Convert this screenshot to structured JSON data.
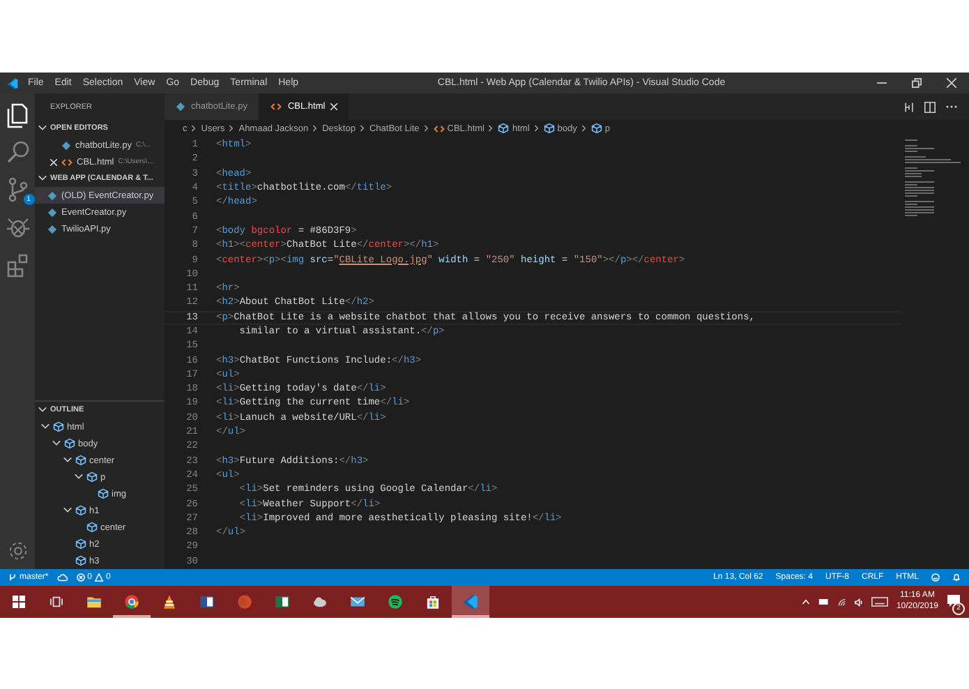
{
  "title_bar": {
    "menu": [
      "File",
      "Edit",
      "Selection",
      "View",
      "Go",
      "Debug",
      "Terminal",
      "Help"
    ],
    "title": "CBL.html - Web App (Calendar & Twilio APIs) - Visual Studio Code"
  },
  "activity_bar": {
    "items": [
      {
        "kind": "files",
        "selected": true
      },
      {
        "kind": "search",
        "selected": false
      },
      {
        "kind": "source-control",
        "selected": false,
        "badge": "1"
      },
      {
        "kind": "debug",
        "selected": false
      },
      {
        "kind": "extensions",
        "selected": false
      }
    ]
  },
  "sidebar": {
    "title": "EXPLORER",
    "sections": [
      {
        "title": "OPEN EDITORS",
        "expanded": true,
        "items": [
          {
            "name": "chatbotLite.py",
            "path": "C:\\...",
            "kind": "python",
            "selected": false,
            "close": false
          },
          {
            "name": "CBL.html",
            "path": "C:\\Users\\...",
            "kind": "html",
            "selected": false,
            "close": true
          }
        ]
      },
      {
        "title": "WEB APP (CALENDAR & T...",
        "expanded": true,
        "items": [
          {
            "name": "(OLD) EventCreator.py",
            "kind": "python",
            "selected": true,
            "close": false
          },
          {
            "name": "EventCreator.py",
            "kind": "python",
            "selected": false,
            "close": false
          },
          {
            "name": "TwilioAPI.py",
            "kind": "python",
            "selected": false,
            "close": false
          }
        ]
      }
    ],
    "outline": {
      "title": "OUTLINE",
      "expanded": true,
      "items": [
        {
          "label": "html",
          "expanded": true,
          "children": [
            {
              "label": "body",
              "expanded": true,
              "children": [
                {
                  "label": "center",
                  "expanded": true,
                  "children": [
                    {
                      "label": "p",
                      "expanded": true,
                      "children": [
                        {
                          "label": "img"
                        }
                      ]
                    }
                  ]
                },
                {
                  "label": "h1",
                  "expanded": true,
                  "children": [
                    {
                      "label": "center"
                    }
                  ]
                },
                {
                  "label": "h2"
                },
                {
                  "label": "h3"
                }
              ]
            }
          ]
        }
      ]
    }
  },
  "tabs": [
    {
      "label": "chatbotLite.py",
      "kind": "python",
      "selected": false
    },
    {
      "label": "CBL.html",
      "kind": "html",
      "selected": true
    }
  ],
  "breadcrumb": [
    {
      "label": "c",
      "kind": "folder"
    },
    {
      "label": "Users",
      "kind": "folder"
    },
    {
      "label": "Ahmaad Jackson",
      "kind": "folder"
    },
    {
      "label": "Desktop",
      "kind": "folder"
    },
    {
      "label": "ChatBot Lite",
      "kind": "folder"
    },
    {
      "label": "CBL.html",
      "kind": "html"
    },
    {
      "label": "html",
      "kind": "symbol"
    },
    {
      "label": "body",
      "kind": "symbol"
    },
    {
      "label": "p",
      "kind": "symbol"
    }
  ],
  "editor": {
    "lines": [
      {
        "number": "1",
        "current": false,
        "tokens": [
          {
            "kind": "punct",
            "text": "<"
          },
          {
            "kind": "tag",
            "text": "html"
          },
          {
            "kind": "punct",
            "text": ">"
          }
        ]
      },
      {
        "number": "2",
        "current": false
      },
      {
        "number": "3",
        "current": false,
        "tokens": [
          {
            "kind": "punct",
            "text": "<"
          },
          {
            "kind": "tag",
            "text": "head"
          },
          {
            "kind": "punct",
            "text": ">"
          }
        ]
      },
      {
        "number": "4",
        "current": false,
        "tokens": [
          {
            "kind": "punct",
            "text": "<"
          },
          {
            "kind": "tag",
            "text": "title"
          },
          {
            "kind": "punct",
            "text": ">"
          },
          {
            "kind": "text",
            "text": "chatbotlite.com"
          },
          {
            "kind": "punct",
            "text": "</"
          },
          {
            "kind": "tag",
            "text": "title"
          },
          {
            "kind": "punct",
            "text": ">"
          }
        ]
      },
      {
        "number": "5",
        "current": false,
        "tokens": [
          {
            "kind": "punct",
            "text": "</"
          },
          {
            "kind": "tag",
            "text": "head"
          },
          {
            "kind": "punct",
            "text": ">"
          }
        ]
      },
      {
        "number": "6",
        "current": false
      },
      {
        "number": "7",
        "current": false,
        "tokens": [
          {
            "kind": "punct",
            "text": "<"
          },
          {
            "kind": "tag",
            "text": "body"
          },
          {
            "kind": "deprecated",
            "text": " bgcolor"
          },
          {
            "kind": "text",
            "text": " = #86D3F9"
          },
          {
            "kind": "punct",
            "text": ">"
          }
        ]
      },
      {
        "number": "8",
        "current": false,
        "tokens": [
          {
            "kind": "punct",
            "text": "<"
          },
          {
            "kind": "tag",
            "text": "h1"
          },
          {
            "kind": "punct",
            "text": "><"
          },
          {
            "kind": "deprecated",
            "text": "center"
          },
          {
            "kind": "punct",
            "text": ">"
          },
          {
            "kind": "text",
            "text": "ChatBot Lite"
          },
          {
            "kind": "punct",
            "text": "</"
          },
          {
            "kind": "deprecated",
            "text": "center"
          },
          {
            "kind": "punct",
            "text": "></"
          },
          {
            "kind": "tag",
            "text": "h1"
          },
          {
            "kind": "punct",
            "text": ">"
          }
        ]
      },
      {
        "number": "9",
        "current": false,
        "tokens": [
          {
            "kind": "punct",
            "text": "<"
          },
          {
            "kind": "deprecated",
            "text": "center"
          },
          {
            "kind": "punct",
            "text": "><"
          },
          {
            "kind": "tag",
            "text": "p"
          },
          {
            "kind": "punct",
            "text": "><"
          },
          {
            "kind": "tag",
            "text": "img"
          },
          {
            "kind": "attr",
            "text": " src"
          },
          {
            "kind": "text",
            "text": "="
          },
          {
            "kind": "string",
            "text": "\""
          },
          {
            "kind": "link",
            "text": "CBLite Logo.jpg"
          },
          {
            "kind": "string",
            "text": "\""
          },
          {
            "kind": "attr",
            "text": " width"
          },
          {
            "kind": "text",
            "text": " = "
          },
          {
            "kind": "string",
            "text": "\"250\""
          },
          {
            "kind": "attr",
            "text": " height"
          },
          {
            "kind": "text",
            "text": " = "
          },
          {
            "kind": "string",
            "text": "\"150\""
          },
          {
            "kind": "punct",
            "text": "></"
          },
          {
            "kind": "tag",
            "text": "p"
          },
          {
            "kind": "punct",
            "text": "></"
          },
          {
            "kind": "deprecated",
            "text": "center"
          },
          {
            "kind": "punct",
            "text": ">"
          }
        ]
      },
      {
        "number": "10",
        "current": false
      },
      {
        "number": "11",
        "current": false,
        "tokens": [
          {
            "kind": "punct",
            "text": "<"
          },
          {
            "kind": "tag",
            "text": "hr"
          },
          {
            "kind": "punct",
            "text": ">"
          }
        ]
      },
      {
        "number": "12",
        "current": false,
        "tokens": [
          {
            "kind": "punct",
            "text": "<"
          },
          {
            "kind": "tag",
            "text": "h2"
          },
          {
            "kind": "punct",
            "text": ">"
          },
          {
            "kind": "text",
            "text": "About ChatBot Lite"
          },
          {
            "kind": "punct",
            "text": "</"
          },
          {
            "kind": "tag",
            "text": "h2"
          },
          {
            "kind": "punct",
            "text": ">"
          }
        ]
      },
      {
        "number": "13",
        "current": true,
        "tokens": [
          {
            "kind": "punct",
            "text": "<"
          },
          {
            "kind": "tag",
            "text": "p"
          },
          {
            "kind": "punct",
            "text": ">"
          },
          {
            "kind": "text",
            "text": "ChatBot Lite is a website chatbot that allows you to receive answers to common questions,"
          }
        ]
      },
      {
        "number": "14",
        "current": false,
        "tokens": [
          {
            "kind": "text",
            "text": "    similar to a virtual assistant."
          },
          {
            "kind": "punct",
            "text": "</"
          },
          {
            "kind": "tag",
            "text": "p"
          },
          {
            "kind": "punct",
            "text": ">"
          }
        ]
      },
      {
        "number": "15",
        "current": false
      },
      {
        "number": "16",
        "current": false,
        "tokens": [
          {
            "kind": "punct",
            "text": "<"
          },
          {
            "kind": "tag",
            "text": "h3"
          },
          {
            "kind": "punct",
            "text": ">"
          },
          {
            "kind": "text",
            "text": "ChatBot Functions Include:"
          },
          {
            "kind": "punct",
            "text": "</"
          },
          {
            "kind": "tag",
            "text": "h3"
          },
          {
            "kind": "punct",
            "text": ">"
          }
        ]
      },
      {
        "number": "17",
        "current": false,
        "tokens": [
          {
            "kind": "punct",
            "text": "<"
          },
          {
            "kind": "tag",
            "text": "ul"
          },
          {
            "kind": "punct",
            "text": ">"
          }
        ]
      },
      {
        "number": "18",
        "current": false,
        "tokens": [
          {
            "kind": "punct",
            "text": "<"
          },
          {
            "kind": "tag",
            "text": "li"
          },
          {
            "kind": "punct",
            "text": ">"
          },
          {
            "kind": "text",
            "text": "Getting today's date"
          },
          {
            "kind": "punct",
            "text": "</"
          },
          {
            "kind": "tag",
            "text": "li"
          },
          {
            "kind": "punct",
            "text": ">"
          }
        ]
      },
      {
        "number": "19",
        "current": false,
        "tokens": [
          {
            "kind": "punct",
            "text": "<"
          },
          {
            "kind": "tag",
            "text": "li"
          },
          {
            "kind": "punct",
            "text": ">"
          },
          {
            "kind": "text",
            "text": "Getting the current time"
          },
          {
            "kind": "punct",
            "text": "</"
          },
          {
            "kind": "tag",
            "text": "li"
          },
          {
            "kind": "punct",
            "text": ">"
          }
        ]
      },
      {
        "number": "20",
        "current": false,
        "tokens": [
          {
            "kind": "punct",
            "text": "<"
          },
          {
            "kind": "tag",
            "text": "li"
          },
          {
            "kind": "punct",
            "text": ">"
          },
          {
            "kind": "text",
            "text": "Lanuch a website/URL"
          },
          {
            "kind": "punct",
            "text": "</"
          },
          {
            "kind": "tag",
            "text": "li"
          },
          {
            "kind": "punct",
            "text": ">"
          }
        ]
      },
      {
        "number": "21",
        "current": false,
        "tokens": [
          {
            "kind": "punct",
            "text": "</"
          },
          {
            "kind": "tag",
            "text": "ul"
          },
          {
            "kind": "punct",
            "text": ">"
          }
        ]
      },
      {
        "number": "22",
        "current": false
      },
      {
        "number": "23",
        "current": false,
        "tokens": [
          {
            "kind": "punct",
            "text": "<"
          },
          {
            "kind": "tag",
            "text": "h3"
          },
          {
            "kind": "punct",
            "text": ">"
          },
          {
            "kind": "text",
            "text": "Future Additions:"
          },
          {
            "kind": "punct",
            "text": "</"
          },
          {
            "kind": "tag",
            "text": "h3"
          },
          {
            "kind": "punct",
            "text": ">"
          }
        ]
      },
      {
        "number": "24",
        "current": false,
        "tokens": [
          {
            "kind": "punct",
            "text": "<"
          },
          {
            "kind": "tag",
            "text": "ul"
          },
          {
            "kind": "punct",
            "text": ">"
          }
        ]
      },
      {
        "number": "25",
        "current": false,
        "tokens": [
          {
            "kind": "punct",
            "text": "    <"
          },
          {
            "kind": "tag",
            "text": "li"
          },
          {
            "kind": "punct",
            "text": ">"
          },
          {
            "kind": "text",
            "text": "Set reminders using Google Calendar"
          },
          {
            "kind": "punct",
            "text": "</"
          },
          {
            "kind": "tag",
            "text": "li"
          },
          {
            "kind": "punct",
            "text": ">"
          }
        ]
      },
      {
        "number": "26",
        "current": false,
        "tokens": [
          {
            "kind": "punct",
            "text": "    <"
          },
          {
            "kind": "tag",
            "text": "li"
          },
          {
            "kind": "punct",
            "text": ">"
          },
          {
            "kind": "text",
            "text": "Weather Support"
          },
          {
            "kind": "punct",
            "text": "</"
          },
          {
            "kind": "tag",
            "text": "li"
          },
          {
            "kind": "punct",
            "text": ">"
          }
        ]
      },
      {
        "number": "27",
        "current": false,
        "tokens": [
          {
            "kind": "punct",
            "text": "    <"
          },
          {
            "kind": "tag",
            "text": "li"
          },
          {
            "kind": "punct",
            "text": ">"
          },
          {
            "kind": "text",
            "text": "Improved and more aesthetically pleasing site!"
          },
          {
            "kind": "punct",
            "text": "</"
          },
          {
            "kind": "tag",
            "text": "li"
          },
          {
            "kind": "punct",
            "text": ">"
          }
        ]
      },
      {
        "number": "28",
        "current": false,
        "tokens": [
          {
            "kind": "punct",
            "text": "</"
          },
          {
            "kind": "tag",
            "text": "ul"
          },
          {
            "kind": "punct",
            "text": ">"
          }
        ]
      },
      {
        "number": "29",
        "current": false
      },
      {
        "number": "30",
        "current": false
      }
    ]
  },
  "status_bar": {
    "branch": "master*",
    "errors": "0",
    "warnings": "0",
    "items": [
      "Ln 13, Col 62",
      "Spaces: 4",
      "UTF-8",
      "CRLF",
      "HTML"
    ]
  },
  "taskbar": {
    "apps": [
      {
        "kind": "folder",
        "selected": false,
        "running": false
      },
      {
        "kind": "browser",
        "selected": false,
        "running": true
      },
      {
        "kind": "cone",
        "selected": false,
        "running": false
      },
      {
        "kind": "word",
        "selected": false,
        "running": false
      },
      {
        "kind": "slides",
        "selected": false,
        "running": false
      },
      {
        "kind": "sheet",
        "selected": false,
        "running": false
      },
      {
        "kind": "cloud",
        "selected": false,
        "running": false
      },
      {
        "kind": "mail",
        "selected": false,
        "running": false
      },
      {
        "kind": "music",
        "selected": false,
        "running": false
      },
      {
        "kind": "bag",
        "selected": false,
        "running": false
      },
      {
        "kind": "code",
        "selected": true,
        "running": true
      }
    ],
    "time": "11:16 AM",
    "date": "10/20/2019",
    "notifications": "2"
  }
}
